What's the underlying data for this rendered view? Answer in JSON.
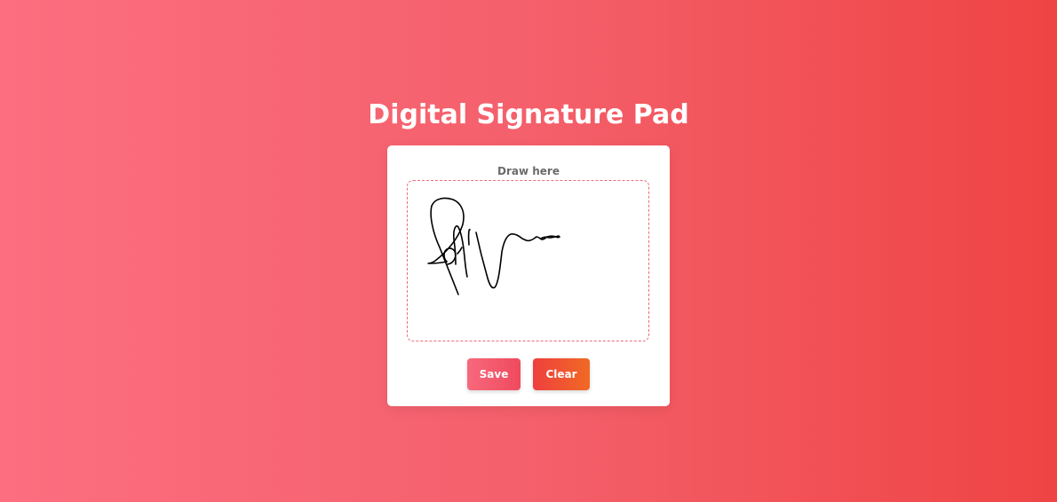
{
  "page": {
    "title": "Digital Signature Pad"
  },
  "pad": {
    "label": "Draw here",
    "has_signature": true
  },
  "actions": {
    "save_label": "Save",
    "clear_label": "Clear"
  },
  "colors": {
    "background_start": "#fc6e80",
    "background_end": "#ef4444",
    "card": "#ffffff",
    "pad_border": "#ee6b7a",
    "ink": "#000000",
    "save_button": "#f15a6e",
    "clear_button": "#ef4f33"
  }
}
